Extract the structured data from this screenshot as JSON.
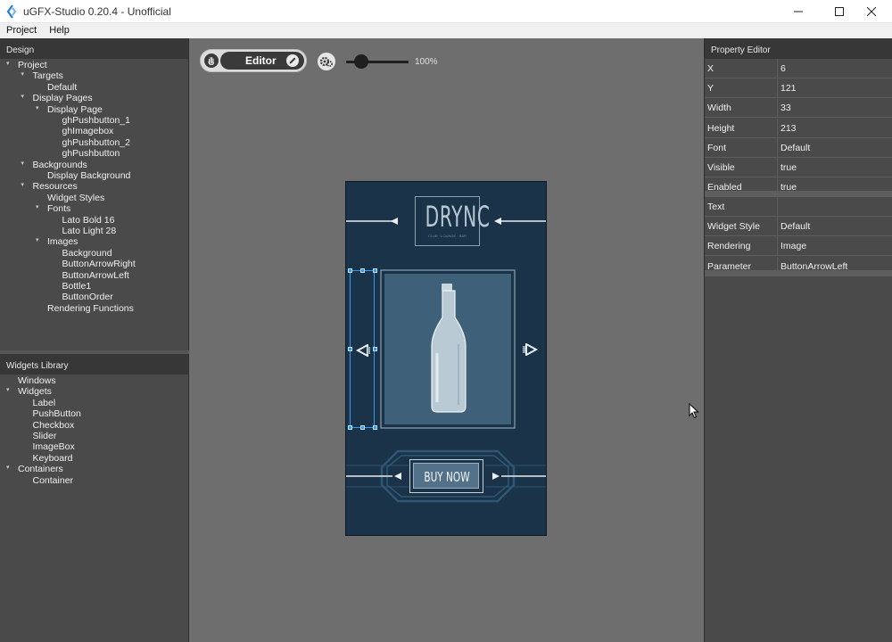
{
  "window": {
    "title": "uGFX-Studio 0.20.4  -  Unofficial"
  },
  "menu": [
    "Project",
    "Help"
  ],
  "design_panel": {
    "title": "Design",
    "tree": [
      {
        "label": "Project",
        "level": 0,
        "expanded": true
      },
      {
        "label": "Targets",
        "level": 1,
        "expanded": true
      },
      {
        "label": "Default",
        "level": 2,
        "expanded": null
      },
      {
        "label": "Display Pages",
        "level": 1,
        "expanded": true
      },
      {
        "label": "Display Page",
        "level": 2,
        "expanded": true
      },
      {
        "label": "ghPushbutton_1",
        "level": 3,
        "expanded": null
      },
      {
        "label": "ghImagebox",
        "level": 3,
        "expanded": null
      },
      {
        "label": "ghPushbutton_2",
        "level": 3,
        "expanded": null
      },
      {
        "label": "ghPushbutton",
        "level": 3,
        "expanded": null
      },
      {
        "label": "Backgrounds",
        "level": 1,
        "expanded": true
      },
      {
        "label": "Display Background",
        "level": 2,
        "expanded": null
      },
      {
        "label": "Resources",
        "level": 1,
        "expanded": true
      },
      {
        "label": "Widget Styles",
        "level": 2,
        "expanded": null
      },
      {
        "label": "Fonts",
        "level": 2,
        "expanded": true
      },
      {
        "label": "Lato Bold 16",
        "level": 3,
        "expanded": null
      },
      {
        "label": "Lato Light 28",
        "level": 3,
        "expanded": null
      },
      {
        "label": "Images",
        "level": 2,
        "expanded": true
      },
      {
        "label": "Background",
        "level": 3,
        "expanded": null
      },
      {
        "label": "ButtonArrowRight",
        "level": 3,
        "expanded": null
      },
      {
        "label": "ButtonArrowLeft",
        "level": 3,
        "expanded": null
      },
      {
        "label": "Bottle1",
        "level": 3,
        "expanded": null
      },
      {
        "label": "ButtonOrder",
        "level": 3,
        "expanded": null
      },
      {
        "label": "Rendering Functions",
        "level": 2,
        "expanded": null
      }
    ]
  },
  "widgets_panel": {
    "title": "Widgets Library",
    "tree": [
      {
        "label": "Windows",
        "level": 0,
        "expanded": null
      },
      {
        "label": "Widgets",
        "level": 0,
        "expanded": true
      },
      {
        "label": "Label",
        "level": 1,
        "expanded": null
      },
      {
        "label": "PushButton",
        "level": 1,
        "expanded": null
      },
      {
        "label": "Checkbox",
        "level": 1,
        "expanded": null
      },
      {
        "label": "Slider",
        "level": 1,
        "expanded": null
      },
      {
        "label": "ImageBox",
        "level": 1,
        "expanded": null
      },
      {
        "label": "Keyboard",
        "level": 1,
        "expanded": null
      },
      {
        "label": "Containers",
        "level": 0,
        "expanded": true
      },
      {
        "label": "Container",
        "level": 1,
        "expanded": null
      }
    ]
  },
  "toolbar": {
    "mode_label": "Editor",
    "zoom_level": "100%",
    "zoom_fraction": 0.15,
    "icons": [
      "hand-icon",
      "pencil-icon",
      "gear-icon"
    ]
  },
  "device_preview": {
    "logo_text": "DRYNC",
    "logo_subtext": "CLUB · LOUNGE · BAR",
    "buy_button_label": "BUY NOW",
    "background_color": "#1a3349",
    "selection_color": "#2a9df4"
  },
  "property_editor": {
    "title": "Property Editor",
    "group1": [
      {
        "key": "X",
        "value": "6"
      },
      {
        "key": "Y",
        "value": "121"
      },
      {
        "key": "Width",
        "value": "33"
      },
      {
        "key": "Height",
        "value": "213"
      },
      {
        "key": "Font",
        "value": "Default"
      },
      {
        "key": "Visible",
        "value": "true"
      },
      {
        "key": "Enabled",
        "value": "true"
      }
    ],
    "group2": [
      {
        "key": "Text",
        "value": ""
      },
      {
        "key": "Widget Style",
        "value": "Default"
      },
      {
        "key": "Rendering",
        "value": "Image"
      },
      {
        "key": "Parameter",
        "value": "ButtonArrowLeft"
      }
    ]
  }
}
